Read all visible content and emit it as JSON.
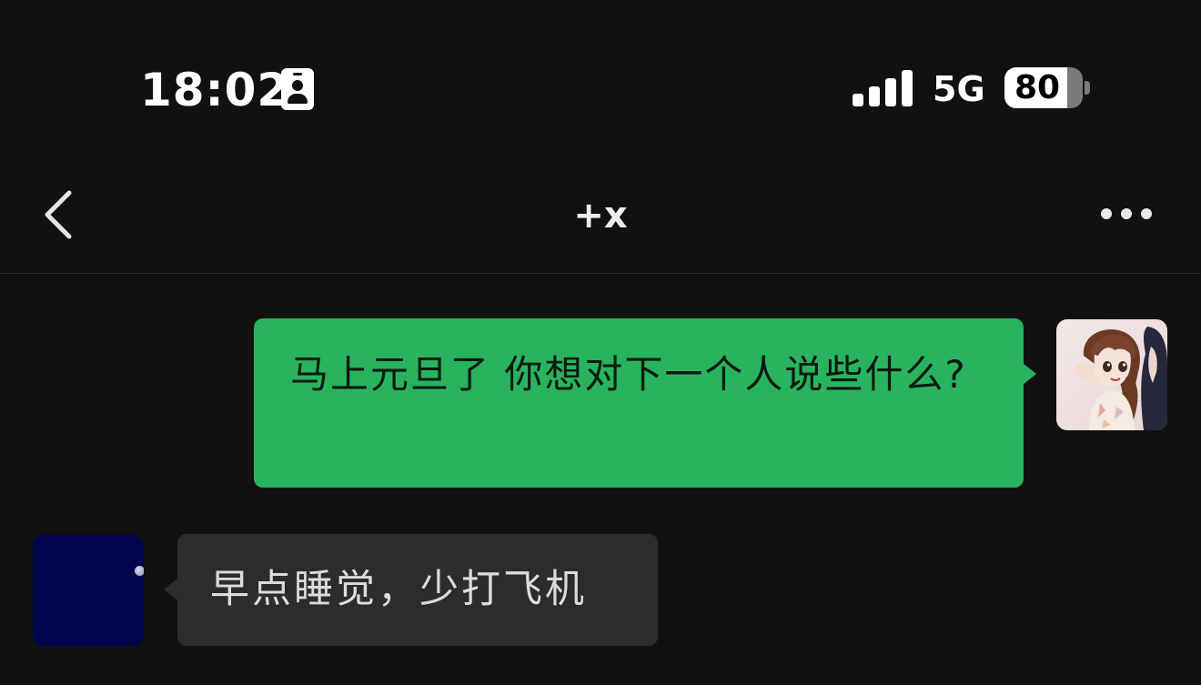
{
  "status_bar": {
    "time": "18:02",
    "network": "5G",
    "battery_level": "80",
    "battery_fraction": 0.8,
    "signal_bars": 4,
    "icons": [
      "id-card-icon",
      "signal-icon",
      "battery-icon"
    ]
  },
  "nav": {
    "title": "+x",
    "back_icon": "chevron-left-icon",
    "more_icon": "ellipsis-icon"
  },
  "messages": [
    {
      "sender": "self",
      "text": "马上元旦了 你想对下一个人说些什么?",
      "bubble_color": "#29b35e"
    },
    {
      "sender": "other",
      "text": "早点睡觉，少打飞机",
      "bubble_color": "#2c2c2c"
    }
  ],
  "colors": {
    "background": "#111111",
    "outgoing_bubble": "#29b35e",
    "incoming_bubble": "#2c2c2c",
    "other_avatar": "#01054d"
  }
}
